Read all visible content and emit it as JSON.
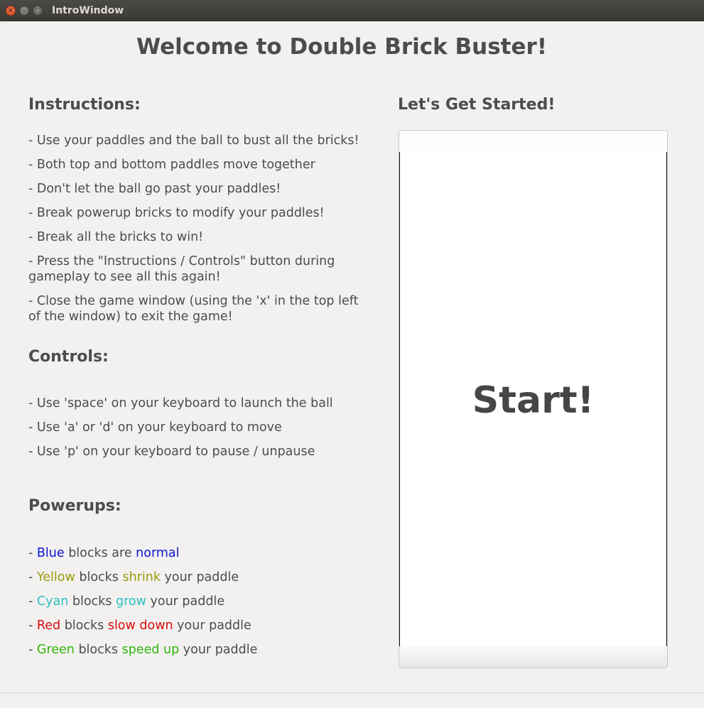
{
  "window": {
    "title": "IntroWindow"
  },
  "welcome": "Welcome to Double Brick Buster!",
  "instructions": {
    "heading": "Instructions:",
    "lines": [
      "- Use your paddles and the ball to bust all the bricks!",
      "- Both top and bottom paddles move together",
      "- Don't let the ball go past your paddles!",
      "- Break powerup bricks to modify your paddles!",
      "- Break all the bricks to win!",
      "- Press the \"Instructions / Controls\" button during gameplay to see all this again!",
      "- Close the game window (using the 'x' in the top left of the window) to exit the game!"
    ]
  },
  "controls": {
    "heading": "Controls:",
    "lines": [
      "- Use 'space' on your keyboard to launch the ball",
      "- Use 'a' or 'd' on your keyboard to move",
      "- Use 'p' on your keyboard to pause / unpause"
    ]
  },
  "powerups": {
    "heading": "Powerups:",
    "items": [
      {
        "prefix": "- ",
        "color_word": "Blue",
        "mid": " blocks are ",
        "effect": "normal",
        "suffix": "",
        "color": "#0b13d4"
      },
      {
        "prefix": "- ",
        "color_word": "Yellow",
        "mid": " blocks ",
        "effect": "shrink",
        "suffix": " your paddle",
        "color": "#9b9b0b"
      },
      {
        "prefix": "- ",
        "color_word": "Cyan",
        "mid": " blocks ",
        "effect": "grow",
        "suffix": " your paddle",
        "color": "#2fbfc0"
      },
      {
        "prefix": "- ",
        "color_word": "Red",
        "mid": " blocks ",
        "effect": "slow down",
        "suffix": " your paddle",
        "color": "#d70c0c"
      },
      {
        "prefix": "- ",
        "color_word": "Green",
        "mid": " blocks ",
        "effect": "speed up",
        "suffix": " your paddle",
        "color": "#34b60b"
      }
    ]
  },
  "start": {
    "heading": "Let's Get Started!",
    "button_label": "Start!"
  }
}
